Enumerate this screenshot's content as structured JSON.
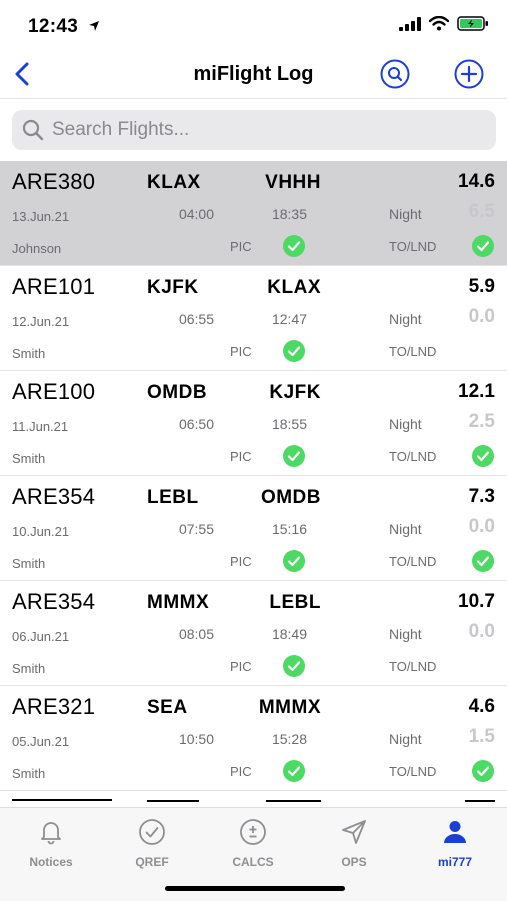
{
  "status": {
    "time": "12:43"
  },
  "nav": {
    "title": "miFlight Log"
  },
  "search": {
    "placeholder": "Search Flights..."
  },
  "labels": {
    "night": "Night",
    "pic": "PIC",
    "tolnd": "TO/LND"
  },
  "colors": {
    "accent": "#1b3fd6",
    "check": "#4cd964",
    "selected_row": "#d2d2d4"
  },
  "flights": [
    {
      "id": "ARE380",
      "from": "KLAX",
      "to": "VHHH",
      "hours": "14.6",
      "date": "13.Jun.21",
      "out": "04:00",
      "in": "18:35",
      "night": "6.5",
      "pilot": "Johnson",
      "pic": true,
      "tolnd": true,
      "selected": true
    },
    {
      "id": "ARE101",
      "from": "KJFK",
      "to": "KLAX",
      "hours": "5.9",
      "date": "12.Jun.21",
      "out": "06:55",
      "in": "12:47",
      "night": "0.0",
      "pilot": "Smith",
      "pic": true,
      "tolnd": false,
      "selected": false
    },
    {
      "id": "ARE100",
      "from": "OMDB",
      "to": "KJFK",
      "hours": "12.1",
      "date": "11.Jun.21",
      "out": "06:50",
      "in": "18:55",
      "night": "2.5",
      "pilot": "Smith",
      "pic": true,
      "tolnd": true,
      "selected": false
    },
    {
      "id": "ARE354",
      "from": "LEBL",
      "to": "OMDB",
      "hours": "7.3",
      "date": "10.Jun.21",
      "out": "07:55",
      "in": "15:16",
      "night": "0.0",
      "pilot": "Smith",
      "pic": true,
      "tolnd": true,
      "selected": false
    },
    {
      "id": "ARE354",
      "from": "MMMX",
      "to": "LEBL",
      "hours": "10.7",
      "date": "06.Jun.21",
      "out": "08:05",
      "in": "18:49",
      "night": "0.0",
      "pilot": "Smith",
      "pic": true,
      "tolnd": false,
      "selected": false
    },
    {
      "id": "ARE321",
      "from": "SEA",
      "to": "MMMX",
      "hours": "4.6",
      "date": "05.Jun.21",
      "out": "10:50",
      "in": "15:28",
      "night": "1.5",
      "pilot": "Smith",
      "pic": true,
      "tolnd": true,
      "selected": false
    }
  ],
  "tabs": [
    {
      "label": "Notices",
      "icon": "bell-icon",
      "active": false
    },
    {
      "label": "QREF",
      "icon": "check-circle-icon",
      "active": false
    },
    {
      "label": "CALCS",
      "icon": "plus-minus-icon",
      "active": false
    },
    {
      "label": "OPS",
      "icon": "paper-plane-icon",
      "active": false
    },
    {
      "label": "mi777",
      "icon": "person-icon",
      "active": true
    }
  ]
}
